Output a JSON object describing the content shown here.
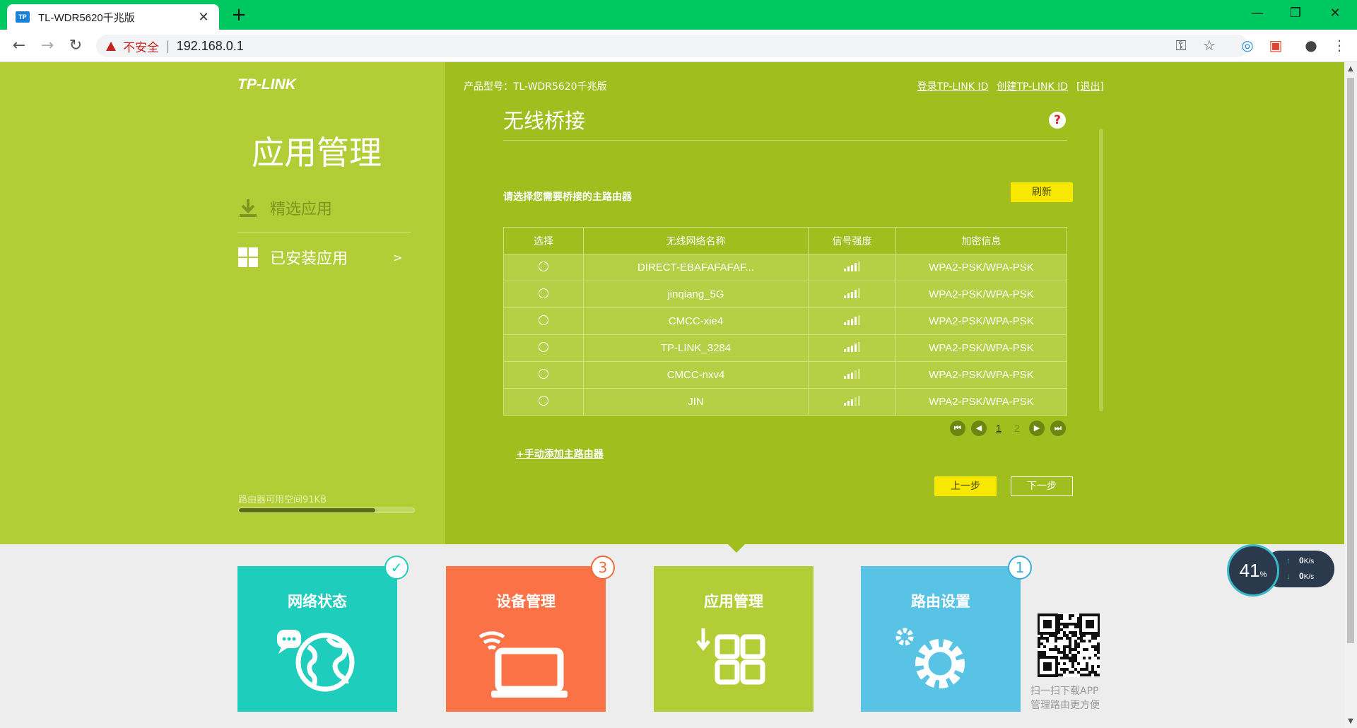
{
  "browser": {
    "tab_title": "TL-WDR5620千兆版",
    "favicon_text": "TP",
    "insecure_label": "不安全",
    "url": "192.168.0.1"
  },
  "header": {
    "logo": "TP-LINK",
    "product_model": "产品型号：TL-WDR5620千兆版",
    "login_link": "登录TP-LINK ID",
    "create_link": "创建TP-LINK ID",
    "logout_link": "[退出]"
  },
  "sidebar": {
    "title": "应用管理",
    "items": [
      {
        "label": "精选应用",
        "icon": "download-icon"
      },
      {
        "label": "已安装应用",
        "icon": "grid-icon",
        "chevron": ">"
      }
    ],
    "space_label": "路由器可用空间91KB",
    "space_fill": 0.78
  },
  "main": {
    "title": "无线桥接",
    "subtitle": "请选择您需要桥接的主路由器",
    "refresh_button": "刷新",
    "columns": [
      "选择",
      "无线网络名称",
      "信号强度",
      "加密信息"
    ],
    "networks": [
      {
        "name": "DIRECT-EBAFAFAFAF...",
        "signal": 4,
        "security": "WPA2-PSK/WPA-PSK"
      },
      {
        "name": "jinqiang_5G",
        "signal": 4,
        "security": "WPA2-PSK/WPA-PSK"
      },
      {
        "name": "CMCC-xie4",
        "signal": 4,
        "security": "WPA2-PSK/WPA-PSK"
      },
      {
        "name": "TP-LINK_3284",
        "signal": 4,
        "security": "WPA2-PSK/WPA-PSK"
      },
      {
        "name": "CMCC-nxv4",
        "signal": 3,
        "security": "WPA2-PSK/WPA-PSK"
      },
      {
        "name": "JIN",
        "signal": 3,
        "security": "WPA2-PSK/WPA-PSK"
      }
    ],
    "pagination": {
      "current": "1",
      "other": "2"
    },
    "manual_add": "+手动添加主路由器",
    "prev_button": "上一步",
    "next_button": "下一步"
  },
  "tiles": [
    {
      "label": "网络状态",
      "color": "#1ecdbb",
      "badge": "✓",
      "badge_color": "#1ecdbb"
    },
    {
      "label": "设备管理",
      "color": "#fa7245",
      "badge": "3",
      "badge_color": "#f26a3c"
    },
    {
      "label": "应用管理",
      "color": "#b3cd36",
      "badge": "",
      "badge_color": ""
    },
    {
      "label": "路由设置",
      "color": "#59c3e5",
      "badge": "1",
      "badge_color": "#3aaed8"
    }
  ],
  "qr": {
    "line1": "扫一扫下载APP",
    "line2": "管理路由更方便"
  },
  "speed_widget": {
    "percent": "41",
    "percent_unit": "%",
    "up": "0",
    "down": "0",
    "unit": "K/s"
  }
}
